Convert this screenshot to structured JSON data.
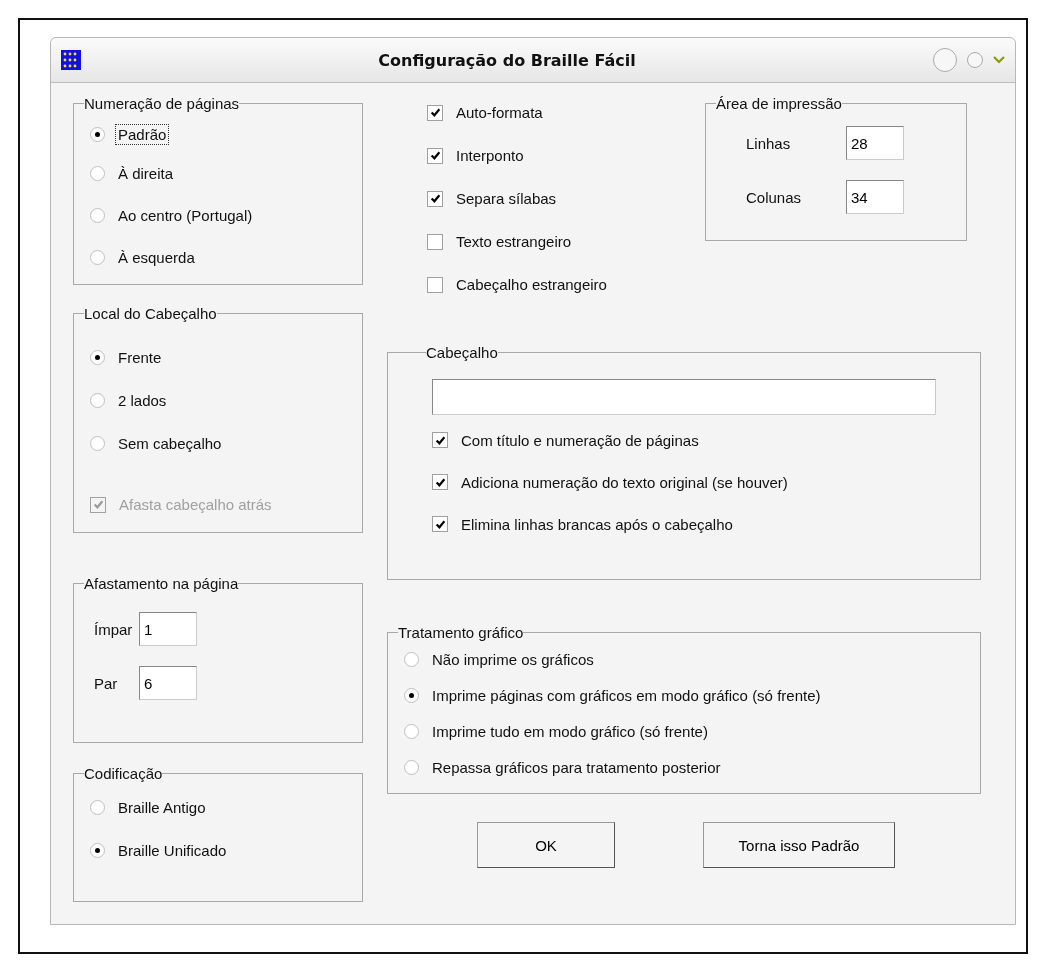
{
  "window": {
    "title": "Configuração do Braille Fácil"
  },
  "page_numbering": {
    "title": "Numeração de páginas",
    "options": [
      {
        "label": "Padrão",
        "selected": true,
        "focused": true
      },
      {
        "label": "À direita",
        "selected": false,
        "focused": false
      },
      {
        "label": "Ao centro (Portugal)",
        "selected": false,
        "focused": false
      },
      {
        "label": "À esquerda",
        "selected": false,
        "focused": false
      }
    ]
  },
  "header_location": {
    "title": "Local do Cabeçalho",
    "options": [
      {
        "label": "Frente",
        "selected": true
      },
      {
        "label": "2 lados",
        "selected": false
      },
      {
        "label": "Sem cabeçalho",
        "selected": false
      }
    ],
    "checkbox": {
      "label": "Afasta cabeçalho atrás",
      "checked": true,
      "disabled": true
    }
  },
  "page_offset": {
    "title": "Afastamento na  página",
    "fields": [
      {
        "label": "Ímpar",
        "value": "1"
      },
      {
        "label": "Par",
        "value": "6"
      }
    ]
  },
  "encoding": {
    "title": "Codificação",
    "options": [
      {
        "label": "Braille Antigo",
        "selected": false
      },
      {
        "label": "Braille Unificado",
        "selected": true
      }
    ]
  },
  "options": [
    {
      "label": "Auto-formata",
      "checked": true
    },
    {
      "label": "Interponto",
      "checked": true
    },
    {
      "label": "Separa sílabas",
      "checked": true
    },
    {
      "label": "Texto estrangeiro",
      "checked": false
    },
    {
      "label": "Cabeçalho estrangeiro",
      "checked": false
    }
  ],
  "print_area": {
    "title": "Área de impressão",
    "fields": [
      {
        "label": "Linhas",
        "value": "28"
      },
      {
        "label": "Colunas",
        "value": "34"
      }
    ]
  },
  "header": {
    "title": "Cabeçalho",
    "options": [
      {
        "label": "Com título e numeração de páginas",
        "checked": true
      },
      {
        "label": "Adiciona numeração do texto original (se houver)",
        "checked": true
      },
      {
        "label": "Elimina linhas brancas após o cabeçalho",
        "checked": true
      }
    ]
  },
  "graphics": {
    "title": "Tratamento gráfico",
    "options": [
      {
        "label": "Não imprime os gráficos",
        "selected": false
      },
      {
        "label": "Imprime páginas com gráficos em modo gráfico (só frente)",
        "selected": true
      },
      {
        "label": "Imprime tudo em modo gráfico (só frente)",
        "selected": false
      },
      {
        "label": "Repassa gráficos para tratamento posterior",
        "selected": false
      }
    ]
  },
  "buttons": [
    "OK",
    "Torna isso Padrão"
  ]
}
